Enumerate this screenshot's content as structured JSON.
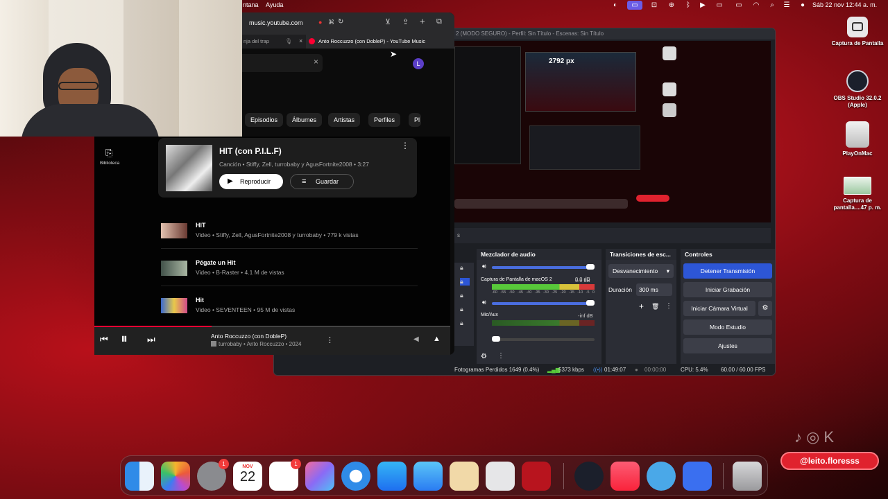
{
  "menubar": {
    "left_items": [
      "ntana",
      "Ayuda"
    ],
    "datetime": "Sáb 22 nov 12:44 a. m."
  },
  "desktop": {
    "icons": [
      {
        "label": "Captura de Pantalla",
        "icon": "screenshot-icon"
      },
      {
        "label": "OBS Studio 32.0.2 (Apple)",
        "icon": "obs-icon"
      },
      {
        "label": "PlayOnMac",
        "icon": "disk-icon"
      },
      {
        "label": "Captura de pantalla....47 p. m.",
        "icon": "image-file-icon"
      }
    ]
  },
  "obs": {
    "title": "2 (MODO SEGURO) - Perfil: Sin Título - Escenas: Sin Título",
    "preview_label": "2792 px",
    "sources_tab": "s",
    "mixer": {
      "title": "Mezclador de audio",
      "ch1_db": "0.0 dB",
      "ch2_name": "Captura de Pantalla de macOS 2",
      "ch2_db": "0.0 dB",
      "ch3_name": "Mic/Aux",
      "ch3_db": "-inf dB",
      "scale": [
        "-60",
        "-55",
        "-50",
        "-45",
        "-40",
        "-35",
        "-30",
        "-25",
        "-20",
        "-15",
        "-10",
        "-5",
        "0"
      ]
    },
    "transitions": {
      "title": "Transiciones de esc...",
      "selected": "Desvanecimiento",
      "duration_label": "Duración",
      "duration_value": "300 ms"
    },
    "controls": {
      "title": "Controles",
      "buttons": [
        "Detener Transmisión",
        "Iniciar Grabación",
        "Iniciar Cámara Virtual",
        "Modo Estudio",
        "Ajustes"
      ]
    },
    "status": {
      "dropped": "Fotogramas Perdidos 1649 (0.4%)",
      "bitrate": "5373 kbps",
      "stream_time": "01:49:07",
      "rec_time": "00:00:00",
      "cpu": "CPU: 5.4%",
      "fps": "60.00 / 60.00 FPS"
    }
  },
  "safari": {
    "url": "music.youtube.com",
    "tab_left": "nja del trap",
    "tab_active": "Anto Roccuzzo (con DobleP) - YouTube Music",
    "avatar_letter": "L"
  },
  "ytm": {
    "chips": [
      "Episodios",
      "Álbumes",
      "Artistas",
      "Perfiles",
      "Pl"
    ],
    "sidebar_label": "Biblioteca",
    "top_result": {
      "title": "HIT (con P.I.L.F)",
      "subtitle": "Canción • Stiffy, Zell, turrobaby y AgusFortnite2008 • 3:27",
      "play": "Reproducir",
      "save": "Guardar"
    },
    "results": [
      {
        "title": "HIT",
        "subtitle": "Video • Stiffy, Zell, AgusFortnite2008 y turrobaby • 779 k vistas"
      },
      {
        "title": "Pégate un Hit",
        "subtitle": "Video • B-Raster • 4.1 M de vistas"
      },
      {
        "title": "Hit",
        "subtitle": "Video • SEVENTEEN • 95 M de vistas"
      }
    ],
    "player": {
      "title": "Anto Roccuzzo (con DobleP)",
      "subtitle": "turrobaby • Anto Roccuzzo • 2024",
      "progress": 0.33
    }
  },
  "dock": {
    "calendar_month": "NOV",
    "calendar_day": "22",
    "badge_settings": "1",
    "badge_reminders": "1"
  },
  "watermark": "@leito.floresss",
  "colors": {
    "accent_blue": "#2d56d6",
    "ytm_red": "#ff0033",
    "meter_green": "#58c83a",
    "meter_yellow": "#d8c23a",
    "meter_red": "#d83a3a"
  }
}
